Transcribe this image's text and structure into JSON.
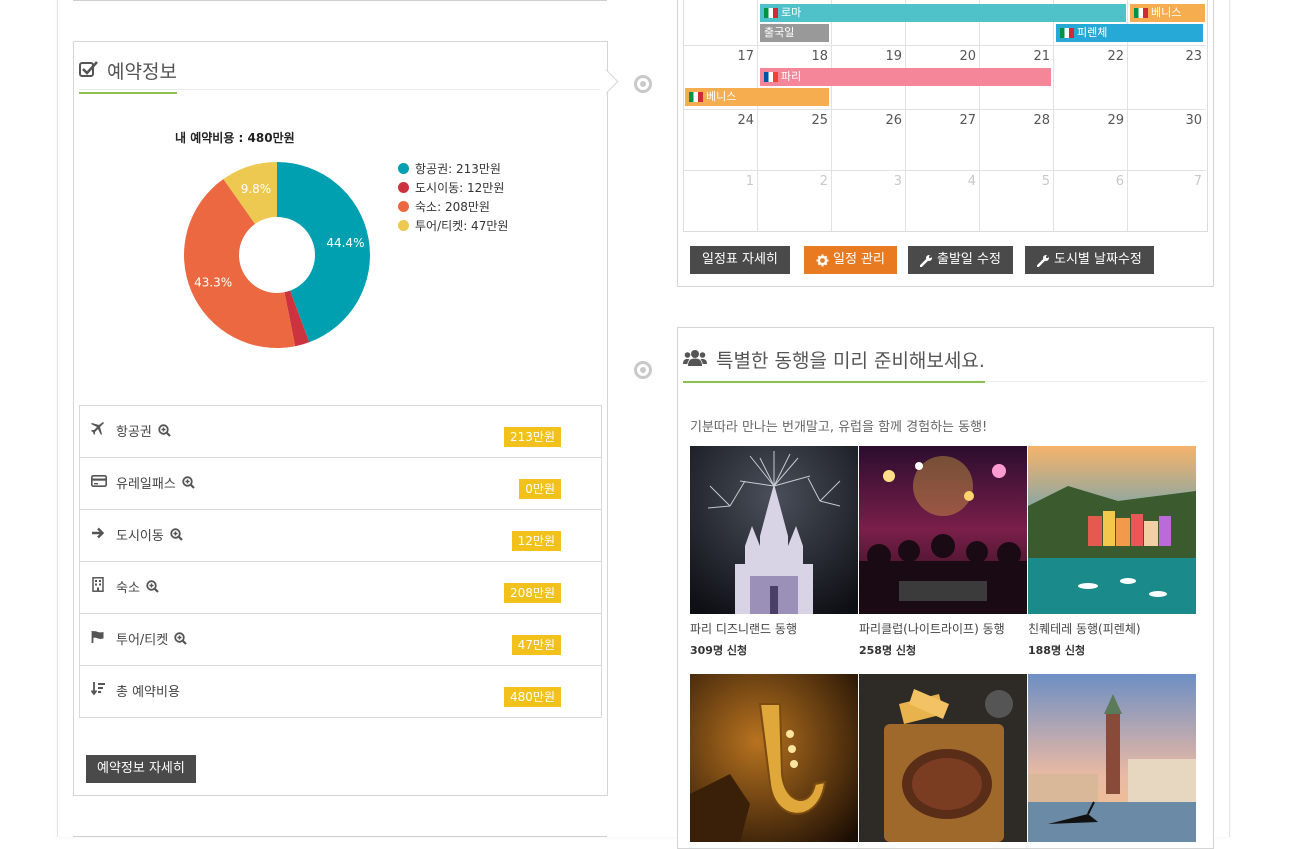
{
  "reservation": {
    "title": "예약정보",
    "chart_data": {
      "type": "pie",
      "title": "내 예약비용 : 480만원",
      "categories": [
        "항공권",
        "도시이동",
        "숙소",
        "투어/티켓"
      ],
      "values": [
        213,
        12,
        208,
        47
      ],
      "percent_labels": [
        "44.4%",
        "",
        "43.3%",
        "9.8%"
      ],
      "colors": [
        "#00a0b0",
        "#cc333f",
        "#eb6841",
        "#edc951"
      ],
      "legend": [
        "항공권: 213만원",
        "도시이동: 12만원",
        "숙소: 208만원",
        "투어/티켓: 47만원"
      ],
      "legend_position": "right",
      "donut": true
    },
    "costs": [
      {
        "label": "항공권",
        "amount": "213만원",
        "icon": "plane-icon"
      },
      {
        "label": "유레일패스",
        "amount": "0만원",
        "icon": "credit-card-icon"
      },
      {
        "label": "도시이동",
        "amount": "12만원",
        "icon": "arrow-right-icon"
      },
      {
        "label": "숙소",
        "amount": "208만원",
        "icon": "building-icon"
      },
      {
        "label": "투어/티켓",
        "amount": "47만원",
        "icon": "flag-icon"
      },
      {
        "label": "총 예약비용",
        "amount": "480만원",
        "icon": "sort-amount-icon"
      }
    ],
    "detail_button": "예약정보 자세히"
  },
  "calendar": {
    "weeks": [
      [
        "17",
        "18",
        "19",
        "20",
        "21",
        "22",
        "23"
      ],
      [
        "24",
        "25",
        "26",
        "27",
        "28",
        "29",
        "30"
      ],
      [
        "1",
        "2",
        "3",
        "4",
        "5",
        "6",
        "7"
      ]
    ],
    "events": [
      {
        "label": "로마",
        "color": "#4fc1c9",
        "flag": "italy"
      },
      {
        "label": "베니스",
        "color": "#f6ad4f",
        "flag": "italy"
      },
      {
        "label": "출국일",
        "color": "#999999",
        "flag": ""
      },
      {
        "label": "피렌체",
        "color": "#27a9d8",
        "flag": "italy"
      },
      {
        "label": "파리",
        "color": "#f5869a",
        "flag": "france"
      },
      {
        "label": "베니스",
        "color": "#f6ad4f",
        "flag": "italy"
      }
    ],
    "buttons": [
      {
        "label": "일정표 자세히",
        "color": "#4a4a4a",
        "icon": ""
      },
      {
        "label": "일정 관리",
        "color": "#e87b22",
        "icon": "gear-icon"
      },
      {
        "label": "출발일 수정",
        "color": "#4a4a4a",
        "icon": "wrench-icon"
      },
      {
        "label": "도시별 날짜수정",
        "color": "#4a4a4a",
        "icon": "wrench-icon"
      }
    ]
  },
  "companions": {
    "title": "특별한 동행을 미리 준비해보세요.",
    "subtitle": "기분따라 만나는 번개말고, 유럽을 함께 경험하는 동행!",
    "items": [
      {
        "title": "파리 디즈니랜드 동행",
        "count": "309명 신청",
        "scene": "castle-fireworks"
      },
      {
        "title": "파리클럽(나이트라이프) 동행",
        "count": "258명 신청",
        "scene": "nightclub"
      },
      {
        "title": "친퀘테레 동행(피렌체)",
        "count": "188명 신청",
        "scene": "cinque-terre"
      },
      {
        "title": "",
        "count": "",
        "scene": "jazz-saxophone"
      },
      {
        "title": "",
        "count": "",
        "scene": "steak-dinner"
      },
      {
        "title": "",
        "count": "",
        "scene": "venice-gondola"
      }
    ]
  }
}
